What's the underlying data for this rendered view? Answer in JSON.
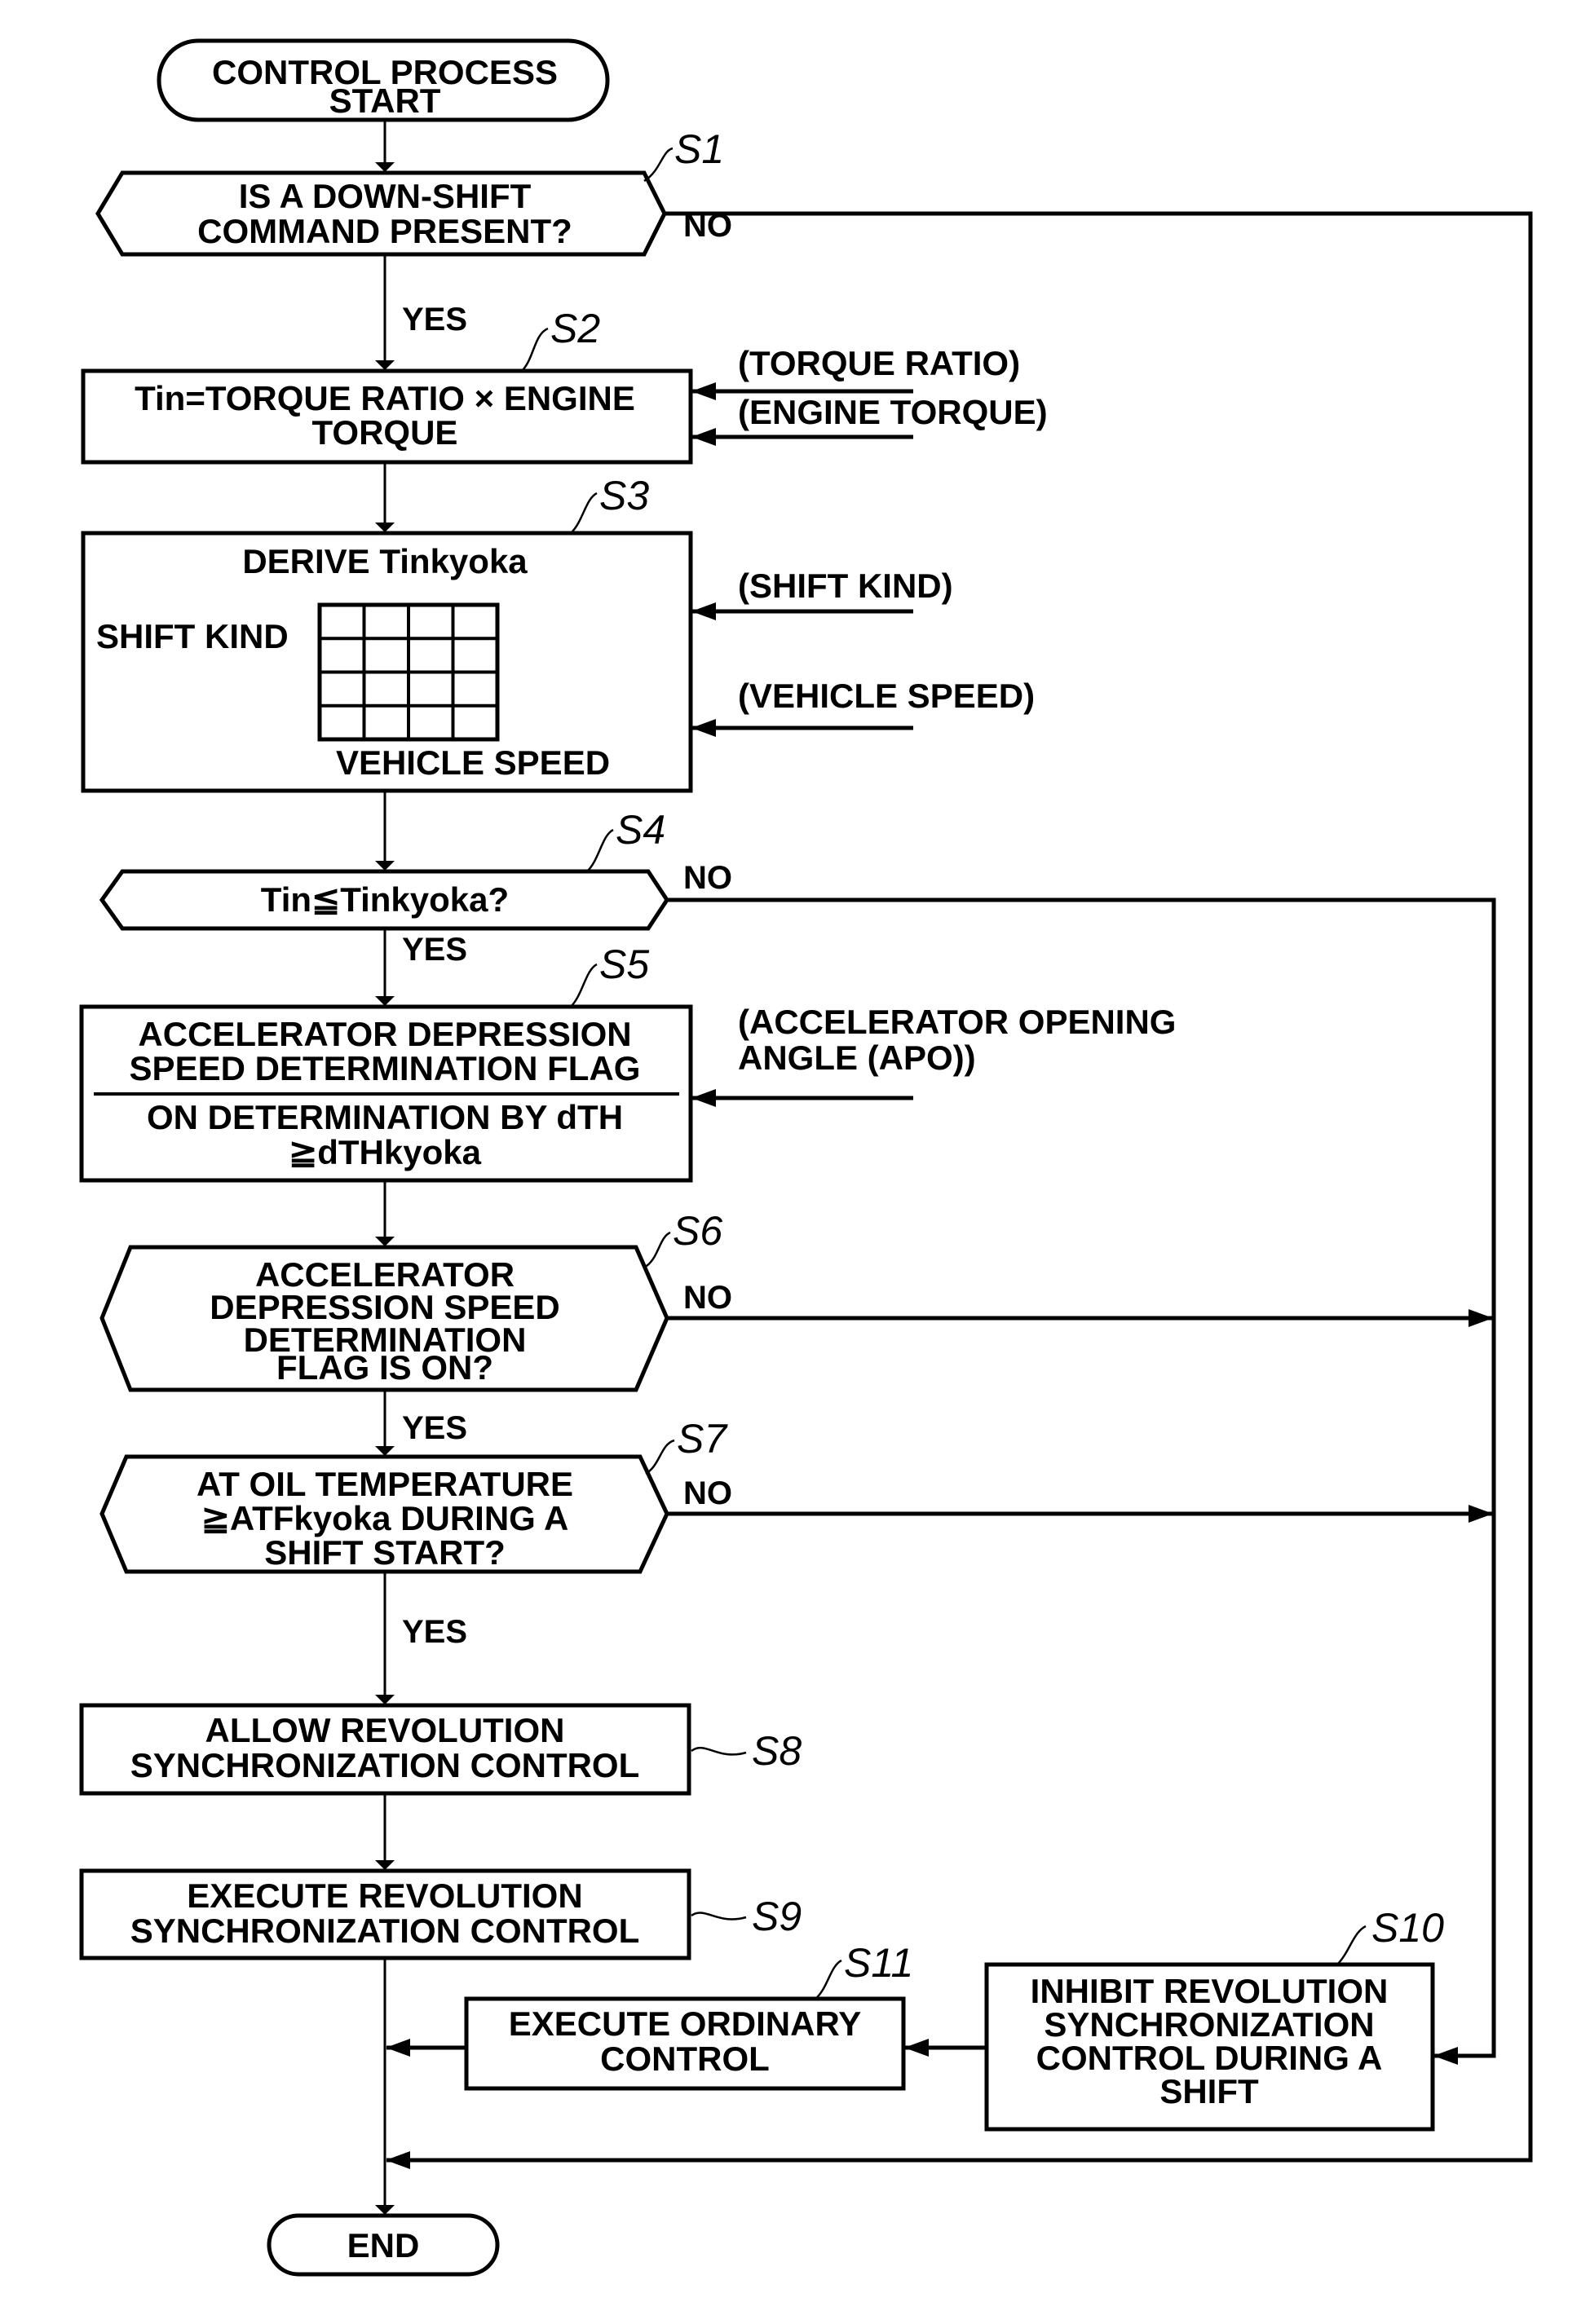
{
  "diagram": {
    "type": "flowchart",
    "start": {
      "lines": [
        "CONTROL PROCESS",
        "START"
      ]
    },
    "end": {
      "label": "END"
    },
    "steps": {
      "S1": {
        "id": "S1",
        "kind": "decision",
        "lines": [
          "IS A DOWN-SHIFT",
          "COMMAND PRESENT?"
        ],
        "yes": "YES",
        "no": "NO"
      },
      "S2": {
        "id": "S2",
        "kind": "process",
        "lines": [
          "Tin=TORQUE RATIO × ENGINE",
          "TORQUE"
        ],
        "inputs": [
          "(TORQUE RATIO)",
          "(ENGINE TORQUE)"
        ]
      },
      "S3": {
        "id": "S3",
        "kind": "process",
        "title": "DERIVE Tinkyoka",
        "map_row_label": "SHIFT KIND",
        "map_col_label": "VEHICLE SPEED",
        "map_rows": 4,
        "map_cols": 4,
        "inputs": [
          "(SHIFT KIND)",
          "(VEHICLE SPEED)"
        ]
      },
      "S4": {
        "id": "S4",
        "kind": "decision",
        "lines": [
          "Tin≦Tinkyoka?"
        ],
        "yes": "YES",
        "no": "NO"
      },
      "S5": {
        "id": "S5",
        "kind": "process",
        "lines_top": [
          "ACCELERATOR DEPRESSION",
          "SPEED DETERMINATION FLAG"
        ],
        "lines_bottom": [
          "ON DETERMINATION BY dTH",
          "≧dTHkyoka"
        ],
        "inputs": [
          "(ACCELERATOR OPENING",
          "ANGLE (APO))"
        ]
      },
      "S6": {
        "id": "S6",
        "kind": "decision",
        "lines": [
          "ACCELERATOR",
          "DEPRESSION SPEED",
          "DETERMINATION",
          "FLAG IS ON?"
        ],
        "yes": "YES",
        "no": "NO"
      },
      "S7": {
        "id": "S7",
        "kind": "decision",
        "lines": [
          "AT OIL TEMPERATURE",
          "≧ATFkyoka DURING A",
          "SHIFT START?"
        ],
        "yes": "YES",
        "no": "NO"
      },
      "S8": {
        "id": "S8",
        "kind": "process",
        "lines": [
          "ALLOW REVOLUTION",
          "SYNCHRONIZATION CONTROL"
        ]
      },
      "S9": {
        "id": "S9",
        "kind": "process",
        "lines": [
          "EXECUTE REVOLUTION",
          "SYNCHRONIZATION CONTROL"
        ]
      },
      "S10": {
        "id": "S10",
        "kind": "process",
        "lines": [
          "INHIBIT REVOLUTION",
          "SYNCHRONIZATION",
          "CONTROL DURING A",
          "SHIFT"
        ]
      },
      "S11": {
        "id": "S11",
        "kind": "process",
        "lines": [
          "EXECUTE ORDINARY",
          "CONTROL"
        ]
      }
    },
    "edges": [
      [
        "START",
        "S1"
      ],
      [
        "S1",
        "S2",
        "YES"
      ],
      [
        "S1",
        "END",
        "NO"
      ],
      [
        "S2",
        "S3"
      ],
      [
        "S3",
        "S4"
      ],
      [
        "S4",
        "S5",
        "YES"
      ],
      [
        "S4",
        "S10",
        "NO"
      ],
      [
        "S5",
        "S6"
      ],
      [
        "S6",
        "S7",
        "YES"
      ],
      [
        "S6",
        "S10",
        "NO"
      ],
      [
        "S7",
        "S8",
        "YES"
      ],
      [
        "S7",
        "S10",
        "NO"
      ],
      [
        "S8",
        "S9"
      ],
      [
        "S9",
        "END"
      ],
      [
        "S10",
        "S11"
      ],
      [
        "S11",
        "END"
      ]
    ]
  }
}
